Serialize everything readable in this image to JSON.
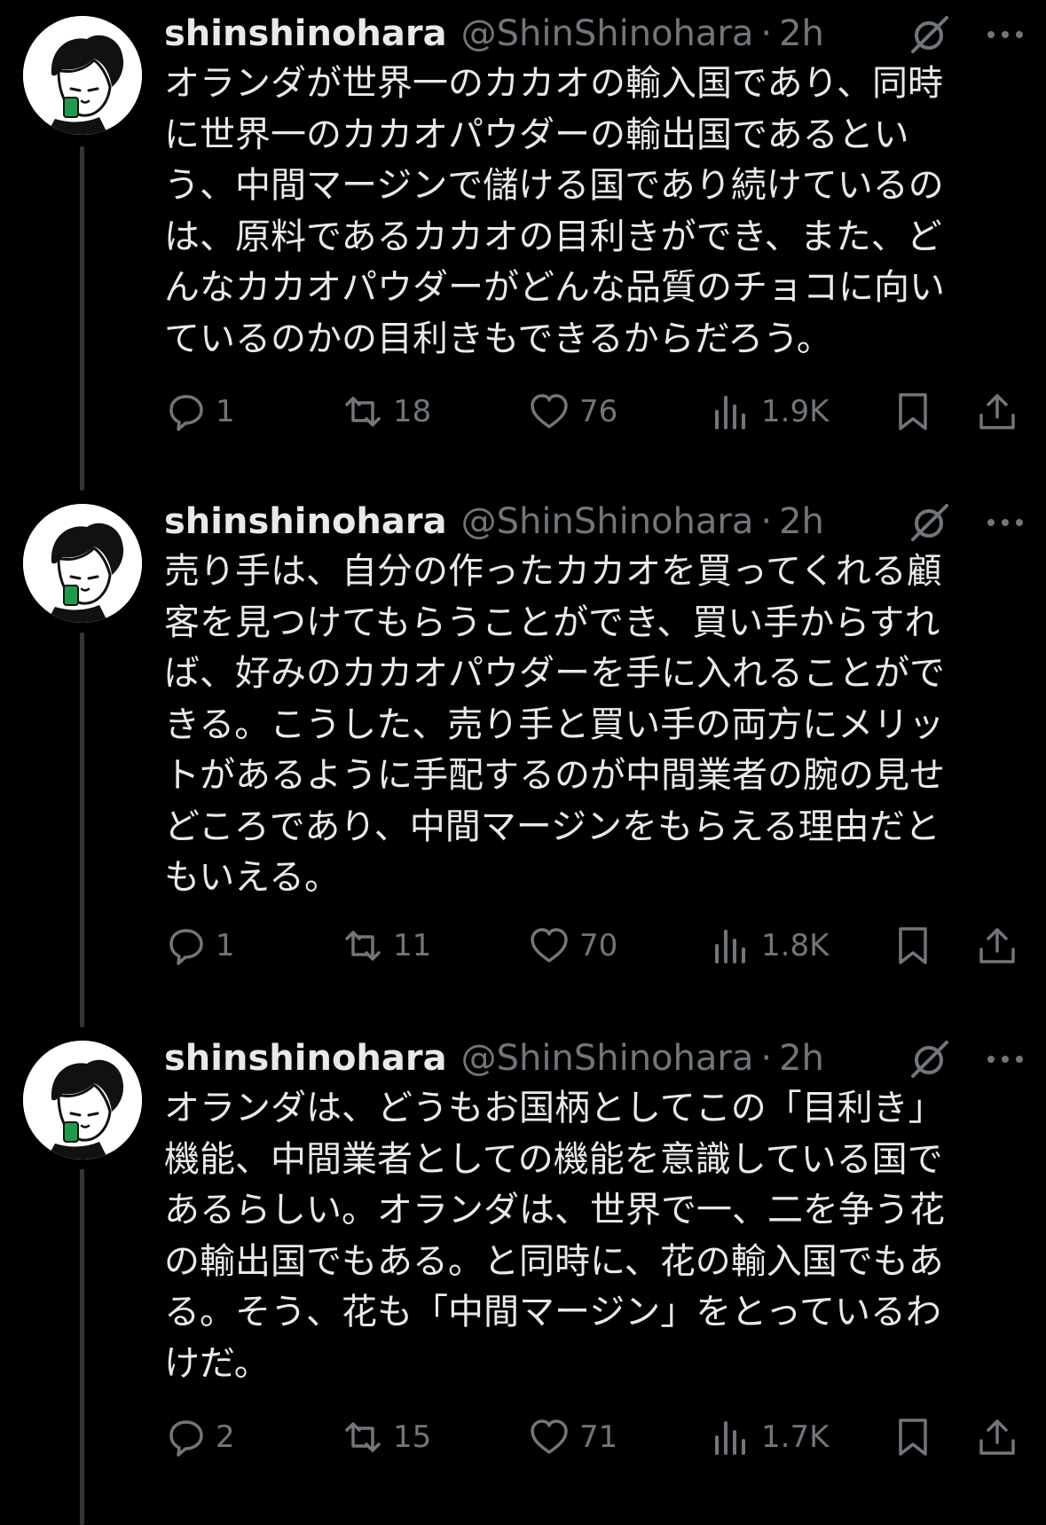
{
  "tweets": [
    {
      "name": "shinshinohara",
      "handle": "@ShinShinohara",
      "separator": "·",
      "time": "2h",
      "text": "オランダが世界一のカカオの輸入国であり、同時\nに世界一のカカオパウダーの輸出国であるとい\nう、中間マージンで儲ける国であり続けているの\nは、原料であるカカオの目利きができ、また、ど\nんなカカオパウダーがどんな品質のチョコに向い\nているのかの目利きもできるからだろう。",
      "replies": "1",
      "retweets": "18",
      "likes": "76",
      "views": "1.9K"
    },
    {
      "name": "shinshinohara",
      "handle": "@ShinShinohara",
      "separator": "·",
      "time": "2h",
      "text": "売り手は、自分の作ったカカオを買ってくれる顧\n客を見つけてもらうことができ、買い手からすれ\nば、好みのカカオパウダーを手に入れることがで\nきる。こうした、売り手と買い手の両方にメリッ\nトがあるように手配するのが中間業者の腕の見せ\nどころであり、中間マージンをもらえる理由だと\nもいえる。",
      "replies": "1",
      "retweets": "11",
      "likes": "70",
      "views": "1.8K"
    },
    {
      "name": "shinshinohara",
      "handle": "@ShinShinohara",
      "separator": "·",
      "time": "2h",
      "text": "オランダは、どうもお国柄としてこの「目利き」\n機能、中間業者としての機能を意識している国で\nあるらしい。オランダは、世界で一、二を争う花\nの輸出国でもある。と同時に、花の輸入国でもあ\nる。そう、花も「中間マージン」をとっているわ\nけだ。",
      "replies": "2",
      "retweets": "15",
      "likes": "71",
      "views": "1.7K"
    }
  ],
  "icons": {
    "avatar": "cartoon-avatar-icon",
    "grok": "grok-icon",
    "more": "more-dots-icon",
    "reply": "reply-icon",
    "retweet": "retweet-icon",
    "like": "heart-icon",
    "views": "views-chart-icon",
    "bookmark": "bookmark-icon",
    "share": "share-icon"
  },
  "colors": {
    "background": "#000000",
    "text": "#e7e9ea",
    "secondary": "#71767b",
    "thread_line": "#333639"
  }
}
